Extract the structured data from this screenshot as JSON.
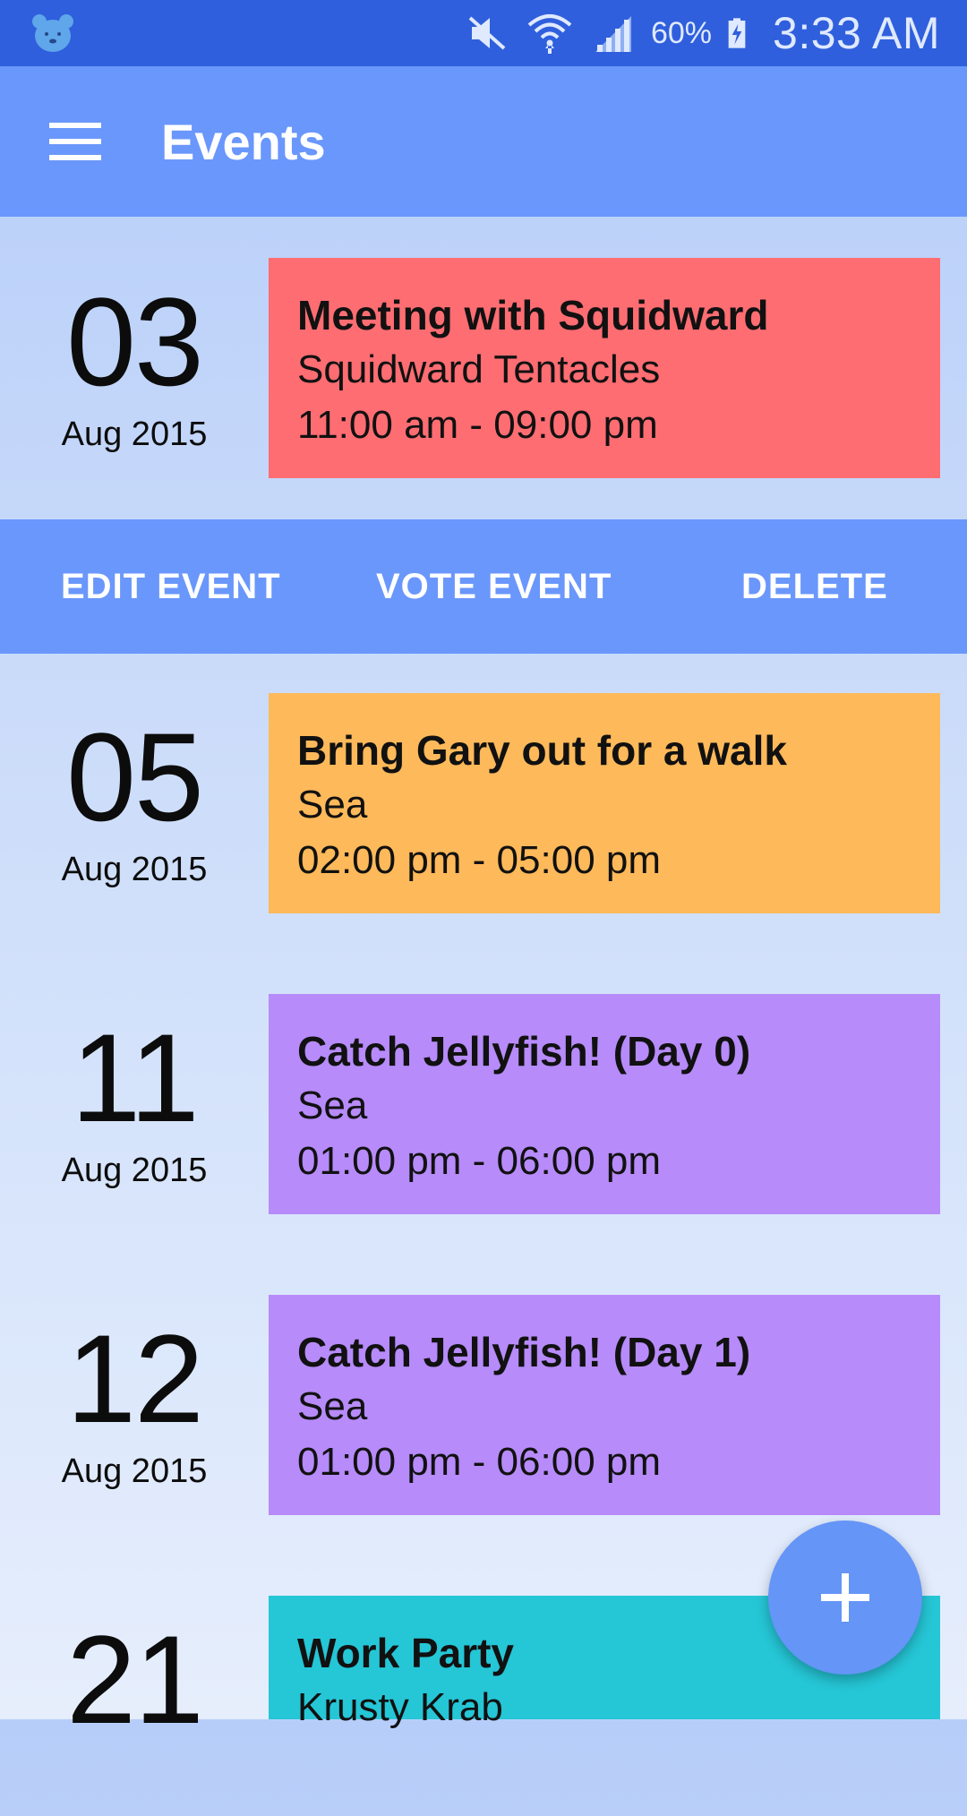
{
  "status_bar": {
    "battery": "60%",
    "time": "3:33 AM",
    "icons": [
      "bear-app-icon",
      "mute-icon",
      "wifi-icon",
      "signal-icon",
      "battery-charging-icon"
    ]
  },
  "app_bar": {
    "title": "Events",
    "menu_icon": "hamburger-menu-icon"
  },
  "actions": {
    "edit": "EDIT EVENT",
    "vote": "VOTE EVENT",
    "delete": "DELETE"
  },
  "events": [
    {
      "day": "03",
      "month": "Aug 2015",
      "title": "Meeting with Squidward",
      "location": "Squidward Tentacles",
      "time": "11:00 am - 09:00 pm",
      "color": "#fe6d72"
    },
    {
      "day": "05",
      "month": "Aug 2015",
      "title": "Bring Gary out for a walk",
      "location": "Sea",
      "time": "02:00 pm - 05:00 pm",
      "color": "#feb95a"
    },
    {
      "day": "11",
      "month": "Aug 2015",
      "title": "Catch Jellyfish! (Day 0)",
      "location": "Sea",
      "time": "01:00 pm - 06:00 pm",
      "color": "#b78bfa"
    },
    {
      "day": "12",
      "month": "Aug 2015",
      "title": "Catch Jellyfish! (Day 1)",
      "location": "Sea",
      "time": "01:00 pm - 06:00 pm",
      "color": "#b78bfa"
    },
    {
      "day": "21",
      "month": "",
      "title": "Work Party",
      "location": "Krusty Krab",
      "time": "",
      "color": "#25c6d6"
    }
  ],
  "fab": {
    "icon": "plus-icon"
  },
  "colors": {
    "status_bar": "#2f5fdc",
    "app_bar": "#6a97fb",
    "fab": "#6495f7"
  }
}
